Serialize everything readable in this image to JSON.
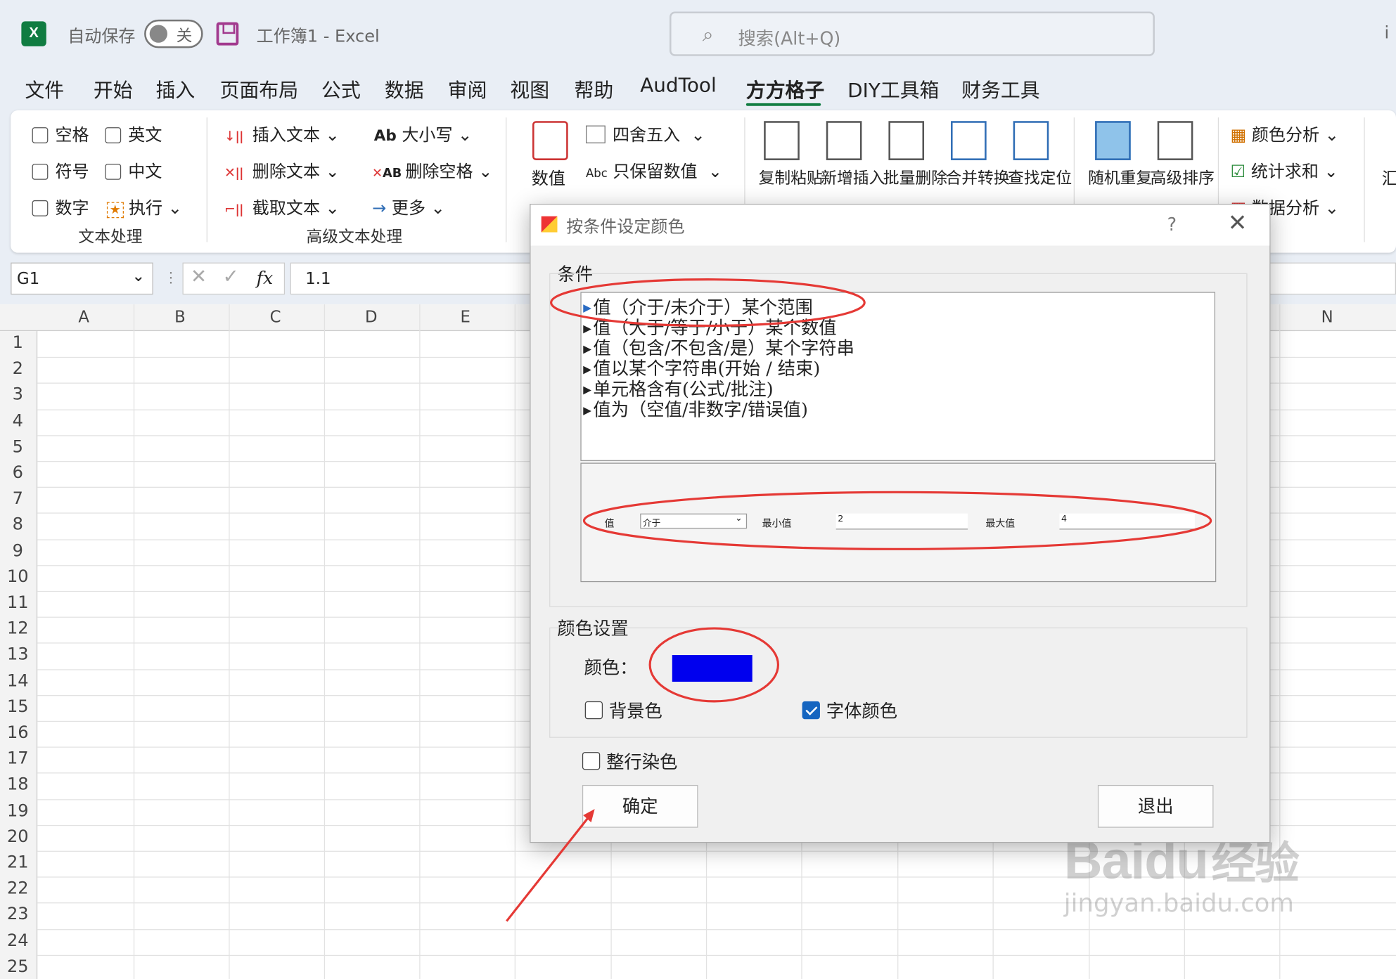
{
  "titlebar": {
    "logo": "X",
    "autosave_label": "自动保存",
    "autosave_state": "关",
    "doc_title": "工作簿1 - Excel",
    "search_placeholder": "搜索(Alt+Q)",
    "right_cut": "i"
  },
  "menu": [
    "文件",
    "开始",
    "插入",
    "页面布局",
    "公式",
    "数据",
    "审阅",
    "视图",
    "帮助",
    "AudTool",
    "方方格子",
    "DIY工具箱",
    "财务工具"
  ],
  "menu_active": "方方格子",
  "ribbon": {
    "text_group": {
      "checks": [
        "空格",
        "英文",
        "符号",
        "中文",
        "数字"
      ],
      "exec": "执行",
      "label": "文本处理"
    },
    "adv_group": {
      "insert": "插入文本",
      "delete": "删除文本",
      "cut": "截取文本",
      "case": "大小写",
      "delspace": "删除空格",
      "more": "更多",
      "label": "高级文本处理"
    },
    "numeric": {
      "big": "数值",
      "round": "四舍五入",
      "keep": "只保留数值"
    },
    "tools": [
      "复制粘贴",
      "新增插入",
      "批量删除",
      "合并转换",
      "查找定位"
    ],
    "tools2": [
      "随机重复",
      "高级排序"
    ],
    "analysis": [
      "颜色分析",
      "统计求和",
      "数据分析"
    ],
    "cut_right": "汇"
  },
  "formula": {
    "name": "G1",
    "value": "1.1",
    "fx": "fx"
  },
  "columns": [
    "A",
    "B",
    "C",
    "D",
    "E",
    "N"
  ],
  "rows": [
    "1",
    "2",
    "3",
    "4",
    "5",
    "6",
    "7",
    "8",
    "9",
    "10",
    "11",
    "12",
    "13",
    "14",
    "15",
    "16",
    "17",
    "18",
    "19",
    "20",
    "21",
    "22",
    "23",
    "24",
    "25"
  ],
  "dialog": {
    "title": "按条件设定颜色",
    "help": "?",
    "close": "✕",
    "cond_label": "条件",
    "conditions": [
      "值（介于/未介于）某个范围",
      "值（大于/等于/小于）某个数值",
      "值（包含/不包含/是）某个字符串",
      "值以某个字符串(开始 / 结束)",
      "单元格含有(公式/批注)",
      "值为（空值/非数字/错误值)"
    ],
    "preview": {
      "value_label": "值",
      "mode": "介于",
      "min_label": "最小值",
      "min_value": "2",
      "max_label": "最大值",
      "max_value": "4"
    },
    "color_label": "颜色设置",
    "color_field": "颜色：",
    "color_hex": "#0000ee",
    "bg_label": "背景色",
    "bg_checked": false,
    "font_label": "字体颜色",
    "font_checked": true,
    "row_label": "整行染色",
    "row_checked": false,
    "ok": "确定",
    "exit": "退出"
  },
  "watermark": {
    "brand": "Baidu",
    "cn": "经验",
    "url": "jingyan.baidu.com"
  },
  "colors": {
    "accent": "#107c41",
    "annotation": "#e53935"
  }
}
